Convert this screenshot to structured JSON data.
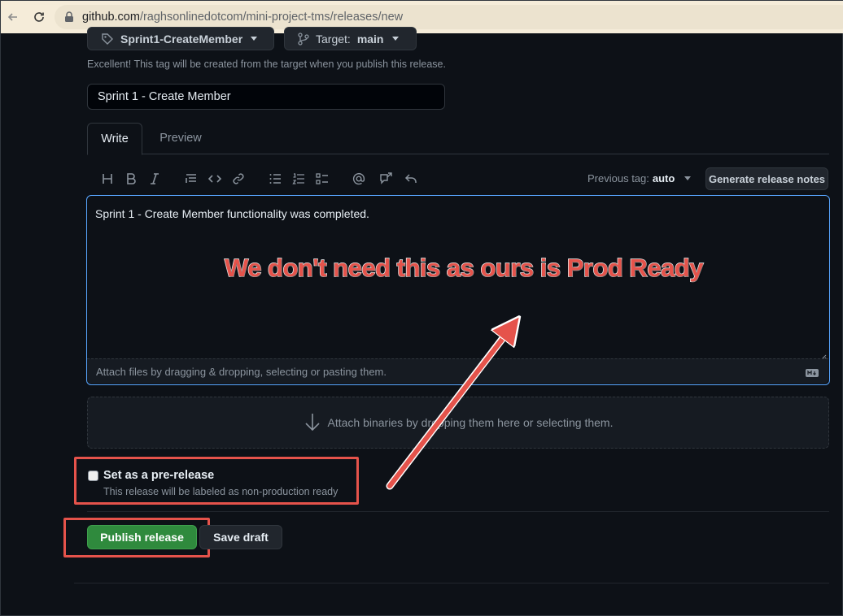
{
  "browser": {
    "url_host": "github.com",
    "url_path": "/raghsonlinedotcom/mini-project-tms/releases/new"
  },
  "tag_select": {
    "label": "Sprint1-CreateMember"
  },
  "target_select": {
    "prefix": "Target:",
    "value": "main"
  },
  "tag_hint": "Excellent! This tag will be created from the target when you publish this release.",
  "release_title": {
    "value": "Sprint 1 - Create Member"
  },
  "tabs": [
    {
      "label": "Write",
      "active": true
    },
    {
      "label": "Preview",
      "active": false
    }
  ],
  "toolbar": {
    "tools": [
      "heading-icon",
      "bold-icon",
      "italic-icon",
      "quote-icon",
      "code-icon",
      "link-icon",
      "bulleted-list-icon",
      "numbered-list-icon",
      "task-list-icon",
      "mention-icon",
      "reference-icon",
      "undo-icon"
    ],
    "previous_tag_label": "Previous tag:",
    "previous_tag_value": "auto",
    "generate_notes_label": "Generate release notes"
  },
  "editor": {
    "body": "Sprint 1 - Create Member functionality was completed.",
    "attach_text": "Attach files by dragging & dropping, selecting or pasting them.",
    "markdown_icon": "markdown-icon"
  },
  "binaries": {
    "text": "Attach binaries by dropping them here or selecting them."
  },
  "prerelease": {
    "label": "Set as a pre-release",
    "hint": "This release will be labeled as non-production ready",
    "checked": false
  },
  "actions": {
    "publish_label": "Publish release",
    "save_draft_label": "Save draft"
  },
  "annotation": {
    "text": "We don't need this as ours is Prod Ready",
    "color": "#e5534b"
  },
  "colors": {
    "background": "#0d1117",
    "accent_blue": "#58a6ff",
    "publish_green": "#2f8a3d",
    "annotation_red": "#e5534b"
  }
}
